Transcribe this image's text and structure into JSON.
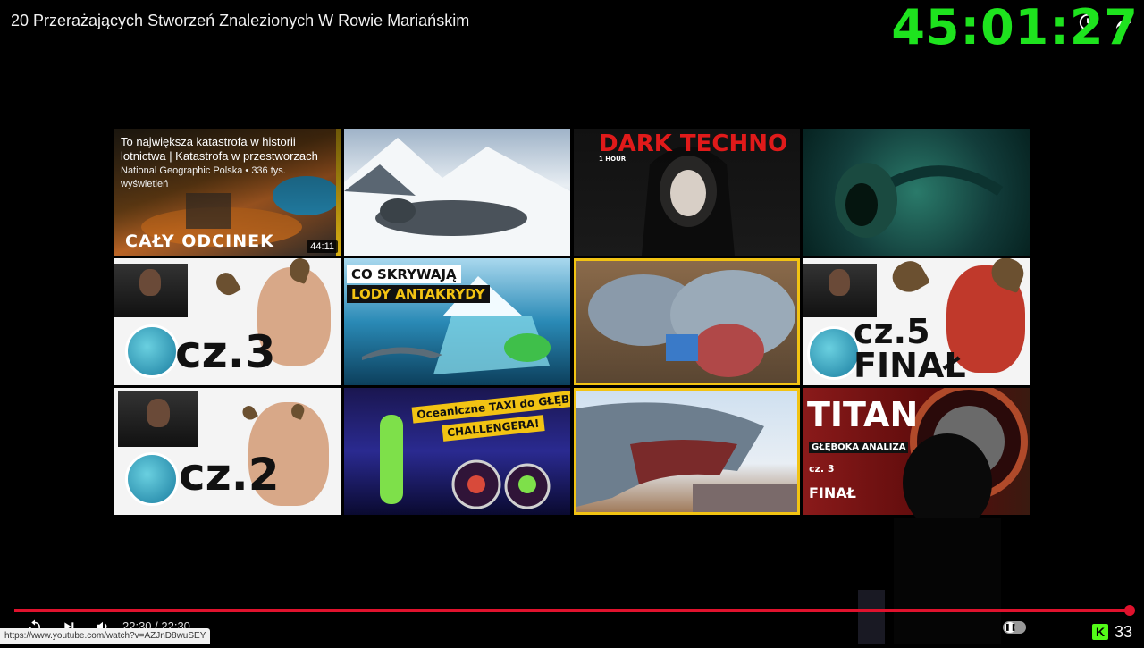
{
  "video": {
    "title": "20 Przerażających Stworzeń Znalezionych W Rowie Mariańskim"
  },
  "overlay": {
    "stream_timer": "45:01:27",
    "viewer_count": "33",
    "brand_color": "#1ee31e"
  },
  "endscreen": {
    "tiles": [
      {
        "thumb_text": "CAŁY ODCINEK",
        "hover_title": "To największa katastrofa w historii lotnictwa | Katastrofa w przestworzach",
        "hover_meta": "National Geographic Polska • 336 tys. wyświetleń",
        "duration": "44:11"
      },
      {
        "thumb_text": ""
      },
      {
        "thumb_text": "DARK TECHNO",
        "sub_text": "1 HOUR"
      },
      {
        "thumb_text": ""
      },
      {
        "thumb_text": "cz.3"
      },
      {
        "thumb_text": "CO SKRYWAJĄ",
        "thumb_text_2": "LODY ANTAKRYDY"
      },
      {
        "thumb_text": ""
      },
      {
        "thumb_text": "cz.5",
        "thumb_text_2": "FINAŁ"
      },
      {
        "thumb_text": "cz.2"
      },
      {
        "thumb_text": "Oceaniczne TAXI do GŁĘBI",
        "thumb_text_2": "CHALLENGERA!"
      },
      {
        "thumb_text": ""
      },
      {
        "thumb_text": "TITAN",
        "thumb_text_2": "GŁĘBOKA ANALIZA",
        "thumb_text_3": "cz. 3",
        "thumb_text_4": "FINAŁ"
      }
    ],
    "selected_border_color": "#f2c313"
  },
  "player": {
    "time_display": "22:30 / 22:30",
    "progress_fraction": 1.0,
    "accent_color": "#e0122d",
    "icons": [
      "replay-icon",
      "next-icon",
      "volume-icon"
    ]
  },
  "status_bar": {
    "url": "https://www.youtube.com/watch?v=AZJnD8wuSEY"
  }
}
